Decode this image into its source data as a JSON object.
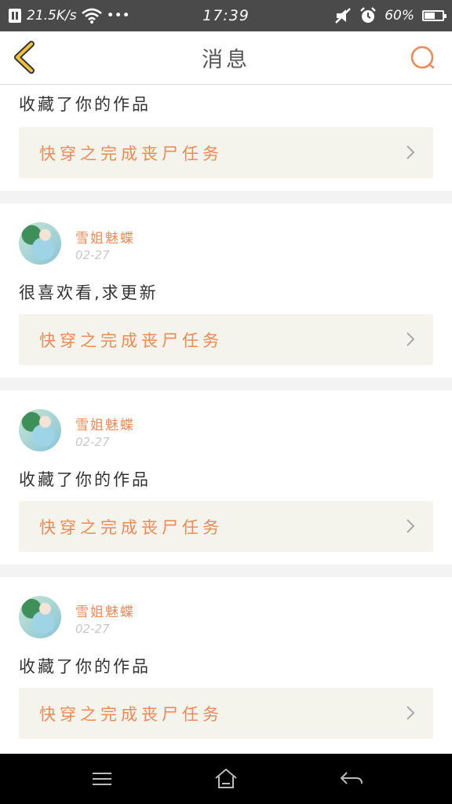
{
  "status": {
    "network_speed": "21.5K/s",
    "dots": "•••",
    "time": "17:39",
    "battery": "60%",
    "battery_level": 0.6
  },
  "header": {
    "title": "消息"
  },
  "first_item": {
    "message": "收藏了你的作品",
    "work_title": "快穿之完成丧尸任务"
  },
  "items": [
    {
      "user": "雪姐魅蝶",
      "date": "02-27",
      "message": "很喜欢看,求更新",
      "work_title": "快穿之完成丧尸任务"
    },
    {
      "user": "雪姐魅蝶",
      "date": "02-27",
      "message": "收藏了你的作品",
      "work_title": "快穿之完成丧尸任务"
    },
    {
      "user": "雪姐魅蝶",
      "date": "02-27",
      "message": "收藏了你的作品",
      "work_title": "快穿之完成丧尸任务"
    }
  ],
  "icons": {
    "back": "back-chevron-icon",
    "search": "search-icon",
    "chevron": "chevron-right-icon",
    "menu": "menu-icon",
    "home": "home-icon",
    "return": "return-icon"
  },
  "colors": {
    "accent": "#ee8a55",
    "back_icon": "#f0c13a",
    "card_bg": "#f4f3ec",
    "status_bar": "#4a4a4a"
  }
}
